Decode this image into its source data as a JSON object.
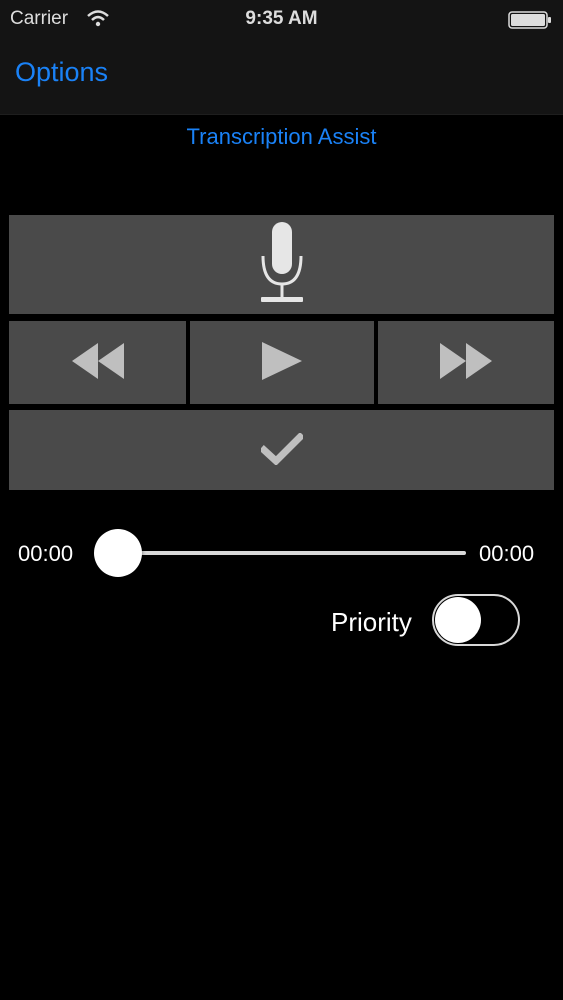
{
  "status_bar": {
    "carrier": "Carrier",
    "time": "9:35 AM",
    "icons": [
      "wifi-icon",
      "battery-icon"
    ]
  },
  "nav": {
    "back_label": "Options"
  },
  "screen": {
    "subtitle": "Transcription Assist"
  },
  "controls": {
    "record": "microphone-icon",
    "rewind": "rewind-icon",
    "play": "play-icon",
    "fast_forward": "fast-forward-icon",
    "confirm": "checkmark-icon"
  },
  "playback": {
    "current_time": "00:00",
    "total_time": "00:00",
    "progress": 0
  },
  "priority": {
    "label": "Priority",
    "enabled": false
  },
  "colors": {
    "accent": "#1a82f7",
    "button_bg": "#4a4a4a",
    "icon": "#bfbfbf",
    "background": "#000000"
  }
}
